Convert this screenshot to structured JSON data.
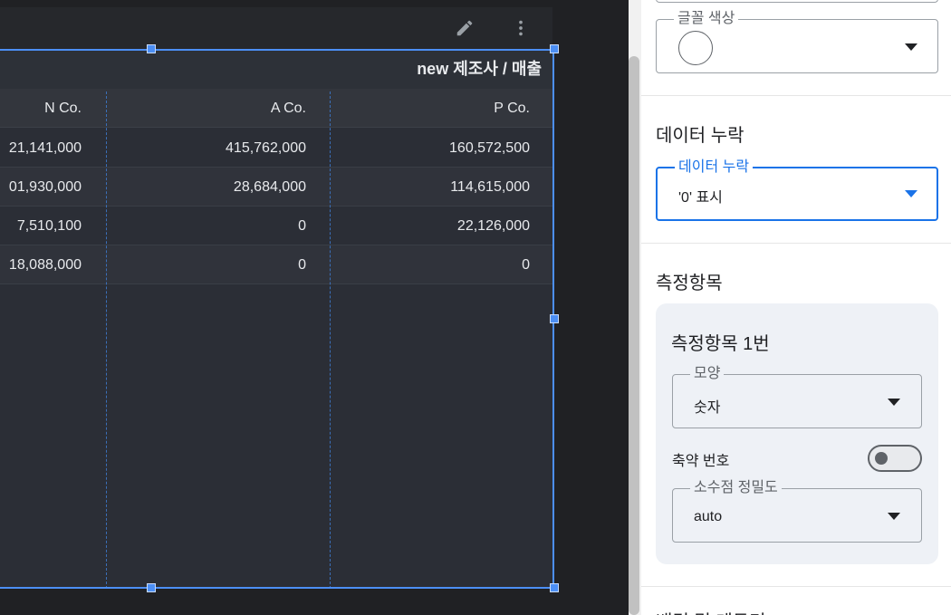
{
  "table": {
    "title": "new 제조사 / 매출",
    "columns": [
      "N Co.",
      "A Co.",
      "P Co."
    ],
    "rows": [
      [
        "21,141,000",
        "415,762,000",
        "160,572,500"
      ],
      [
        "01,930,000",
        "28,684,000",
        "114,615,000"
      ],
      [
        "7,510,100",
        "0",
        "22,126,000"
      ],
      [
        "18,088,000",
        "0",
        "0"
      ]
    ]
  },
  "toolbar": {
    "edit_icon": "pencil-icon",
    "more_icon": "more-vert-icon"
  },
  "panel": {
    "font_color": {
      "label": "글꼴 색상",
      "swatch_color": "#ffffff"
    },
    "missing_data": {
      "section_title": "데이터 누락",
      "field_label": "데이터 누락",
      "value": "'0' 표시"
    },
    "metrics": {
      "section_title": "측정항목",
      "card_title": "측정항목 1번",
      "shape": {
        "label": "모양",
        "value": "숫자"
      },
      "compact_numbers": {
        "label": "축약 번호",
        "enabled": false
      },
      "decimal_precision": {
        "label": "소수점 정밀도",
        "value": "auto"
      }
    },
    "next_section_partial": "배경 및 테두리"
  },
  "colors": {
    "accent": "#1a73e8",
    "selection": "#4c8ff5",
    "canvas_bg": "#202124",
    "table_bg": "#2b2e36"
  }
}
